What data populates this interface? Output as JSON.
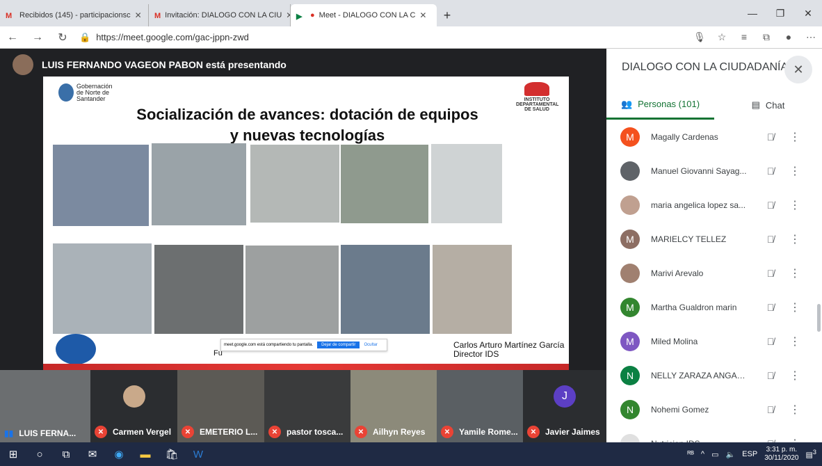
{
  "browser": {
    "tabs": [
      {
        "label": "Recibidos (145) - participacionsc",
        "icon": "gmail-icon"
      },
      {
        "label": "Invitación: DIALOGO CON LA CIU",
        "icon": "gmail-icon"
      },
      {
        "label": "Meet - DIALOGO CON LA C",
        "icon": "meet-icon",
        "active": true
      }
    ],
    "new_tab": "+",
    "url": "https://meet.google.com/gac-jppn-zwd"
  },
  "presenting": {
    "text": "LUIS FERNANDO VAGEON PABON está presentando"
  },
  "slide": {
    "title_line1": "Socialización de avances: dotación de equipos",
    "title_line2": "y nuevas tecnologías",
    "gob_logo": "Gobernación de Norte de Santander",
    "gob_sub": "Instituto Departamental de Salud",
    "ids_logo": "INSTITUTO DEPARTAMENTAL DE SALUD",
    "footer_mid": "Fu",
    "footer_right_1": "Carlos  Arturo Martínez García",
    "footer_right_2": "Director IDS",
    "share_msg": "meet.google.com está compartiendo tu pantalla.",
    "share_stop": "Dejar de compartir",
    "share_hide": "Ocultar"
  },
  "tiles": [
    {
      "name": "LUIS FERNA...",
      "speaking": true
    },
    {
      "name": "Carmen Vergel"
    },
    {
      "name": "EMETERIO L..."
    },
    {
      "name": "pastor tosca..."
    },
    {
      "name": "Ailhyn Reyes"
    },
    {
      "name": "Yamile Rome..."
    },
    {
      "name": "Javier Jaimes",
      "initial": "J"
    }
  ],
  "panel": {
    "title": "DIALOGO CON LA CIUDADANÍA",
    "tab_people": "Personas (101)",
    "tab_chat": "Chat",
    "people": [
      {
        "name": "Magally Cardenas",
        "initial": "M",
        "color": "#f4511e"
      },
      {
        "name": "Manuel Giovanni Sayag...",
        "initial": "",
        "color": "#5f6368"
      },
      {
        "name": "maria angelica lopez sa...",
        "initial": "",
        "color": "#c0a090"
      },
      {
        "name": "MARIELCY TELLEZ",
        "initial": "M",
        "color": "#8d6e63"
      },
      {
        "name": "Marivi Arevalo",
        "initial": "",
        "color": "#a08070"
      },
      {
        "name": "Martha Gualdron marin",
        "initial": "M",
        "color": "#33862f"
      },
      {
        "name": "Miled Molina",
        "initial": "M",
        "color": "#7e57c2"
      },
      {
        "name": "NELLY ZARAZA ANGARI...",
        "initial": "N",
        "color": "#0b8043"
      },
      {
        "name": "Nohemi Gomez",
        "initial": "N",
        "color": "#33862f"
      },
      {
        "name": "Nutricion IDS",
        "initial": "",
        "color": "#e0e0e0"
      }
    ]
  },
  "taskbar": {
    "lang": "ESP",
    "time": "3:31 p. m.",
    "date": "30/11/2020",
    "notif": "3"
  }
}
